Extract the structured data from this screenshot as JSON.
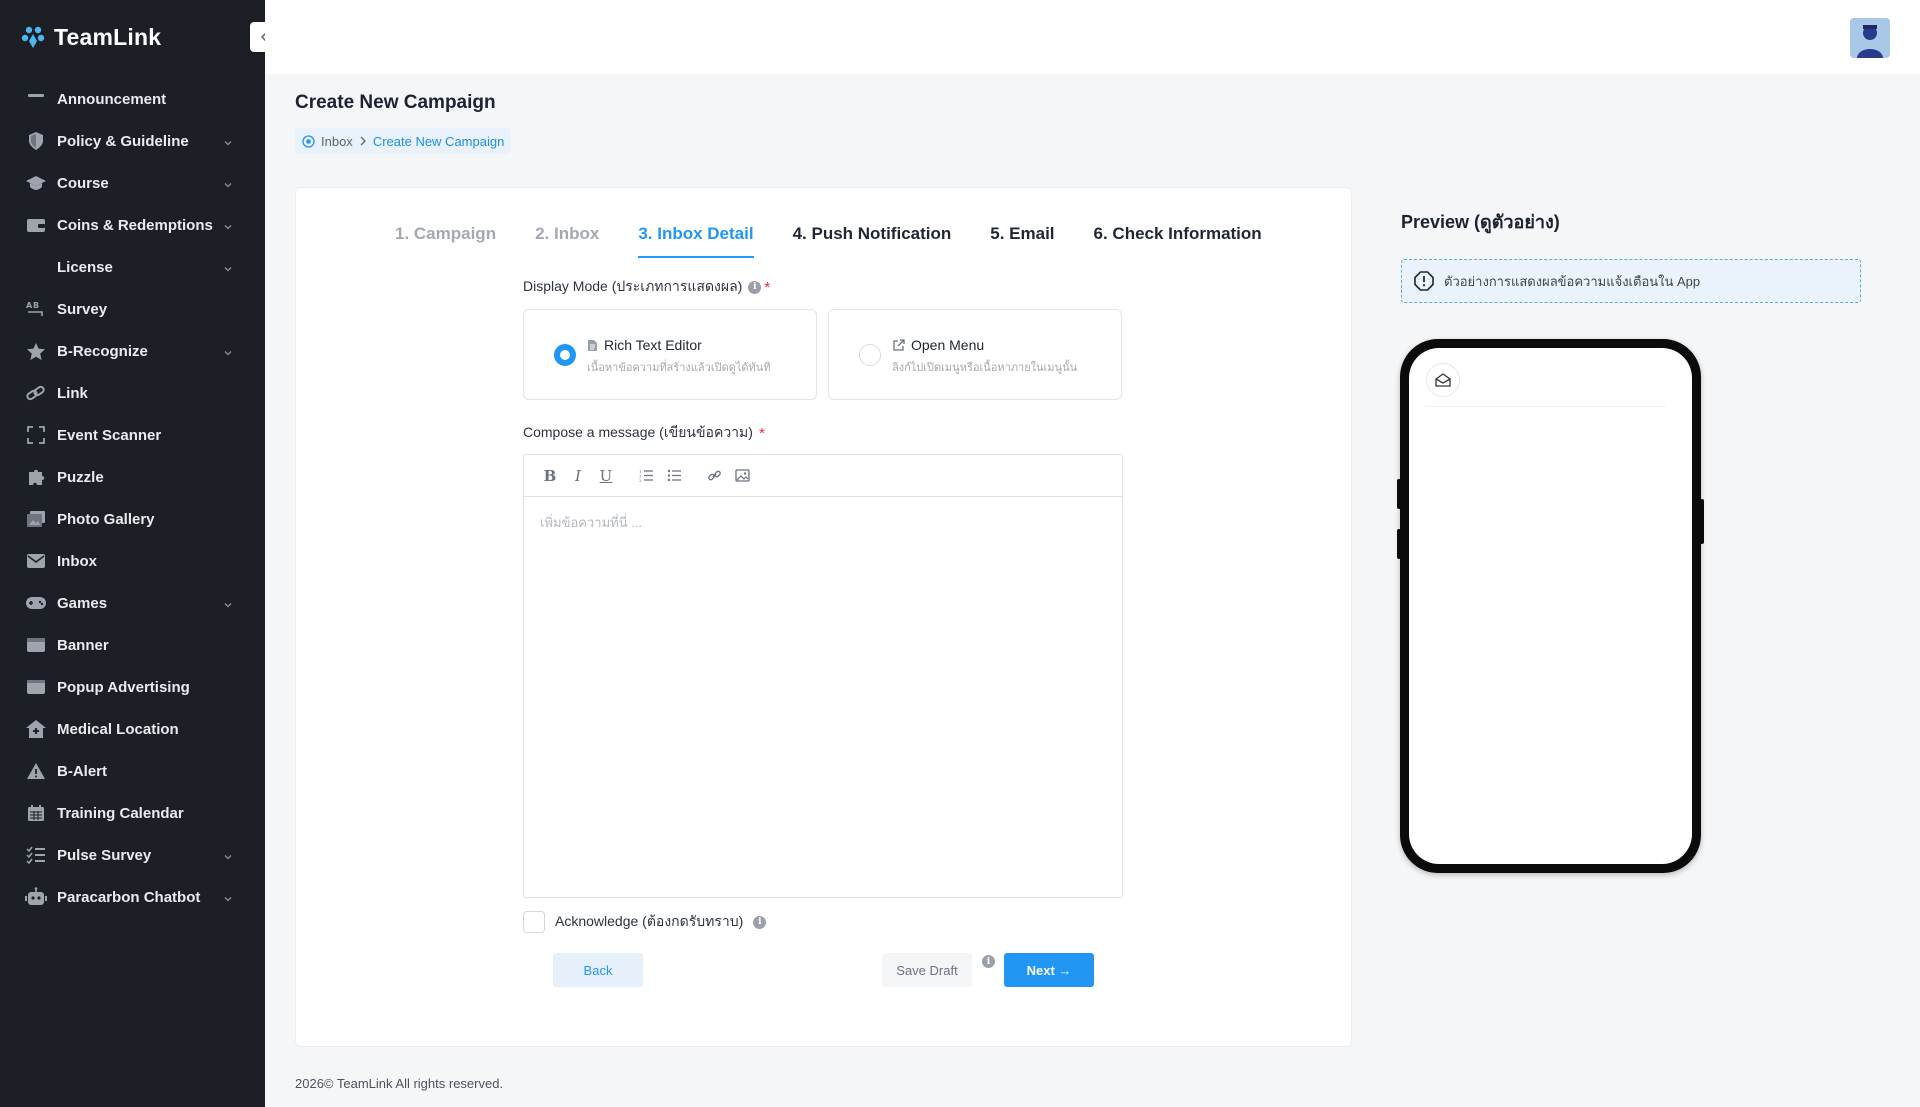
{
  "app": {
    "brand": "TeamLink"
  },
  "sidebar": {
    "items": [
      {
        "label": "Announcement",
        "icon": "announcement-icon",
        "expandable": false
      },
      {
        "label": "Policy & Guideline",
        "icon": "shield-icon",
        "expandable": true
      },
      {
        "label": "Course",
        "icon": "graduation-cap-icon",
        "expandable": true
      },
      {
        "label": "Coins & Redemptions",
        "icon": "wallet-icon",
        "expandable": true
      },
      {
        "label": "License",
        "icon": "",
        "expandable": true
      },
      {
        "label": "Survey",
        "icon": "ab-test-icon",
        "expandable": false
      },
      {
        "label": "B-Recognize",
        "icon": "star-icon",
        "expandable": true
      },
      {
        "label": "Link",
        "icon": "link-icon",
        "expandable": false
      },
      {
        "label": "Event Scanner",
        "icon": "scanner-icon",
        "expandable": false
      },
      {
        "label": "Puzzle",
        "icon": "puzzle-icon",
        "expandable": false
      },
      {
        "label": "Photo Gallery",
        "icon": "gallery-icon",
        "expandable": false
      },
      {
        "label": "Inbox",
        "icon": "envelope-icon",
        "expandable": false
      },
      {
        "label": "Games",
        "icon": "gamepad-icon",
        "expandable": true
      },
      {
        "label": "Banner",
        "icon": "banner-icon",
        "expandable": false
      },
      {
        "label": "Popup Advertising",
        "icon": "popup-icon",
        "expandable": false
      },
      {
        "label": "Medical Location",
        "icon": "medical-house-icon",
        "expandable": false
      },
      {
        "label": "B-Alert",
        "icon": "warning-icon",
        "expandable": false
      },
      {
        "label": "Training Calendar",
        "icon": "calendar-icon",
        "expandable": false
      },
      {
        "label": "Pulse Survey",
        "icon": "checklist-icon",
        "expandable": true
      },
      {
        "label": "Paracarbon Chatbot",
        "icon": "robot-icon",
        "expandable": true
      }
    ]
  },
  "page": {
    "title": "Create New Campaign",
    "breadcrumb": {
      "root": "Inbox",
      "current": "Create New Campaign"
    }
  },
  "steps": {
    "items": [
      {
        "label": "1. Campaign",
        "state": "done"
      },
      {
        "label": "2. Inbox",
        "state": "done"
      },
      {
        "label": "3. Inbox Detail",
        "state": "active"
      },
      {
        "label": "4. Push Notification",
        "state": "todo"
      },
      {
        "label": "5. Email",
        "state": "todo"
      },
      {
        "label": "6. Check Information",
        "state": "todo"
      }
    ]
  },
  "form": {
    "display_mode_label": "Display Mode (ประเภทการแสดงผล)",
    "required_mark": "*",
    "modes": [
      {
        "title": "Rich Text Editor",
        "subtitle": "เนื้อหาข้อความที่สร้างแล้วเปิดดูได้ทันที",
        "selected": true,
        "icon": "document-icon"
      },
      {
        "title": "Open Menu",
        "subtitle": "ลิงก์ไปเปิดเมนูหรือเนื้อหาภายในเมนูนั้น",
        "selected": false,
        "icon": "external-link-icon"
      }
    ],
    "compose_label": "Compose a message (เขียนข้อความ)",
    "editor_placeholder": "เพิ่มข้อความที่นี่ ...",
    "acknowledge_label": "Acknowledge (ต้องกดรับทราบ)",
    "acknowledge_checked": false,
    "buttons": {
      "back": "Back",
      "save_draft": "Save Draft",
      "next": "Next →"
    }
  },
  "preview": {
    "title": "Preview (ดูตัวอย่าง)",
    "note": "ตัวอย่างการแสดงผลข้อความแจ้งเตือนใน App"
  },
  "footer": {
    "text": "2026© TeamLink All rights reserved."
  },
  "colors": {
    "accent": "#2196f3",
    "sidebar_bg": "#1c1f26",
    "required": "#e5303a"
  }
}
